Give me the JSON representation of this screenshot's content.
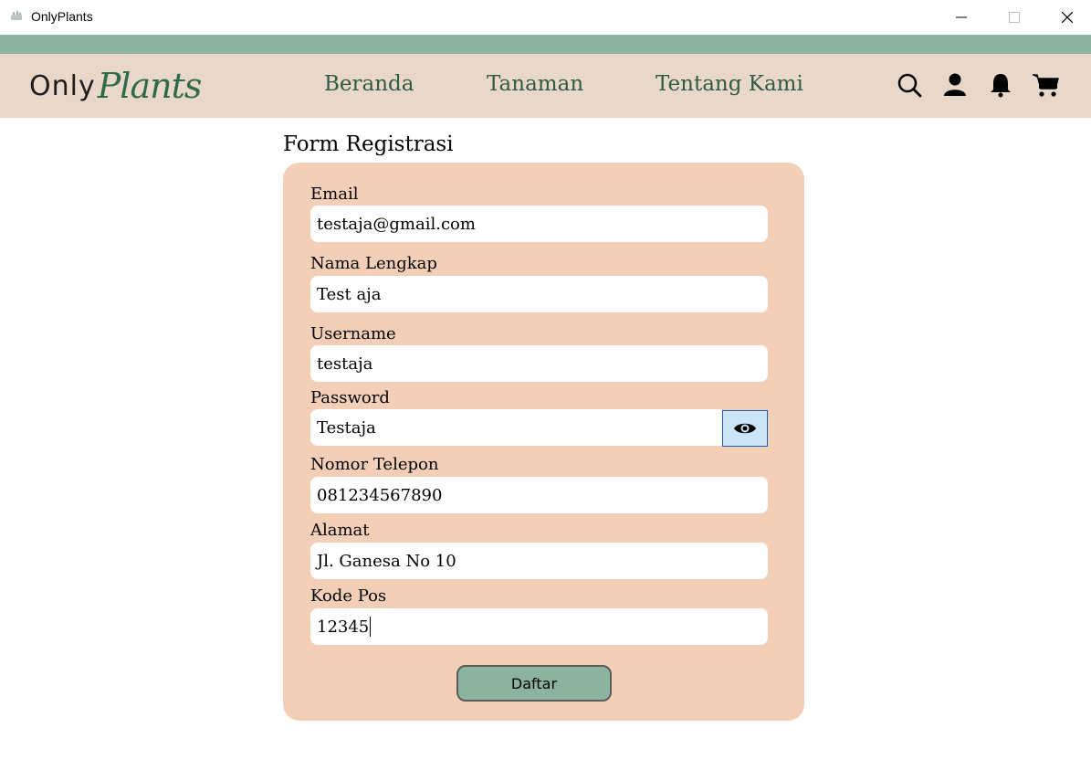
{
  "window": {
    "title": "OnlyPlants"
  },
  "header": {
    "logo_only": "Only",
    "logo_plants": "Plants",
    "nav": [
      {
        "label": "Beranda"
      },
      {
        "label": "Tanaman"
      },
      {
        "label": "Tentang Kami"
      }
    ],
    "icons": [
      "search-icon",
      "user-icon",
      "bell-icon",
      "cart-icon"
    ]
  },
  "form": {
    "title": "Form Registrasi",
    "fields": [
      {
        "label": "Email",
        "value": "testaja@gmail.com"
      },
      {
        "label": "Nama Lengkap",
        "value": "Test aja"
      },
      {
        "label": "Username",
        "value": "testaja"
      },
      {
        "label": "Password",
        "value": "Testaja"
      },
      {
        "label": "Nomor Telepon",
        "value": "081234567890"
      },
      {
        "label": "Alamat",
        "value": "Jl. Ganesa No 10"
      },
      {
        "label": "Kode Pos",
        "value": "12345"
      }
    ],
    "submit_label": "Daftar"
  },
  "colors": {
    "accent_green": "#8bb3a0",
    "navbar_bg": "#e9d8ca",
    "card_bg": "#f3cfb7",
    "nav_text": "#2f5a45"
  }
}
